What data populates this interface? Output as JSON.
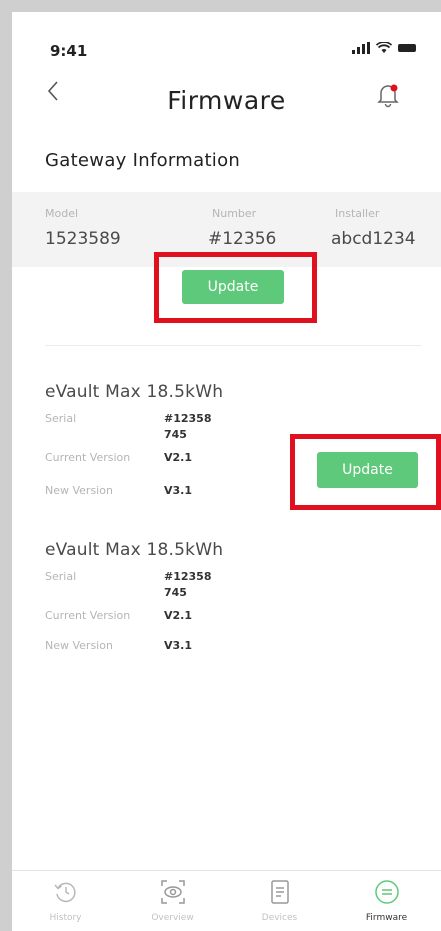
{
  "status_bar": {
    "time": "9:41"
  },
  "header": {
    "title": "Firmware"
  },
  "gateway": {
    "section_title": "Gateway Information",
    "fields": [
      {
        "label": "Model",
        "value": "1523589"
      },
      {
        "label": "Number",
        "value": "#12356"
      },
      {
        "label": "Installer",
        "value": "abcd1234"
      }
    ],
    "update_label": "Update"
  },
  "devices": [
    {
      "name": "eVault Max 18.5kWh",
      "serial_label": "Serial",
      "serial_line1": "#12358",
      "serial_line2": "745",
      "current_label": "Current Version",
      "current_value": "V2.1",
      "new_label": "New Version",
      "new_value": "V3.1",
      "update_label": "Update"
    },
    {
      "name": "eVault Max 18.5kWh",
      "serial_label": "Serial",
      "serial_line1": "#12358",
      "serial_line2": "745",
      "current_label": "Current Version",
      "current_value": "V2.1",
      "new_label": "New Version",
      "new_value": "V3.1"
    }
  ],
  "bottom_nav": [
    {
      "label": "History",
      "icon": "history-icon",
      "active": false
    },
    {
      "label": "Overview",
      "icon": "overview-icon",
      "active": false
    },
    {
      "label": "Devices",
      "icon": "devices-icon",
      "active": false
    },
    {
      "label": "Firmware",
      "icon": "firmware-icon",
      "active": true
    }
  ],
  "colors": {
    "accent_green": "#5ec97a",
    "highlight_red": "#e0111e",
    "notification_dot": "#e0111e",
    "panel_bg": "#f3f3f3"
  }
}
